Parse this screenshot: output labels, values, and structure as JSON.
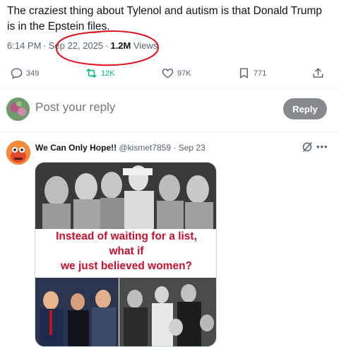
{
  "tweet": {
    "text": "The craziest thing about Tylenol and autism is that Donald Trump is in the Epstein files.",
    "time": "6:14 PM",
    "date": "Sep 22, 2025",
    "views_count": "1.2M",
    "views_label": "Views",
    "separator": "·"
  },
  "actions": {
    "reply_count": "349",
    "retweet_count": "12K",
    "like_count": "97K",
    "bookmark_count": "771"
  },
  "compose": {
    "placeholder": "Post your reply",
    "reply_button_label": "Reply"
  },
  "reply": {
    "name": "We Can Only Hope!!",
    "handle": "@kismet7859",
    "separator": "·",
    "date": "Sep 23",
    "more_label": "•••",
    "media_caption": {
      "line1": "Instead of waiting for a list,",
      "line2": "what if",
      "line3": "we just believed women?"
    }
  },
  "colors": {
    "annotation_circle": "#e0101a",
    "caption_text": "#c8102e",
    "retweet_green": "#00ba7c",
    "reply_button_bg": "#878a8d"
  }
}
